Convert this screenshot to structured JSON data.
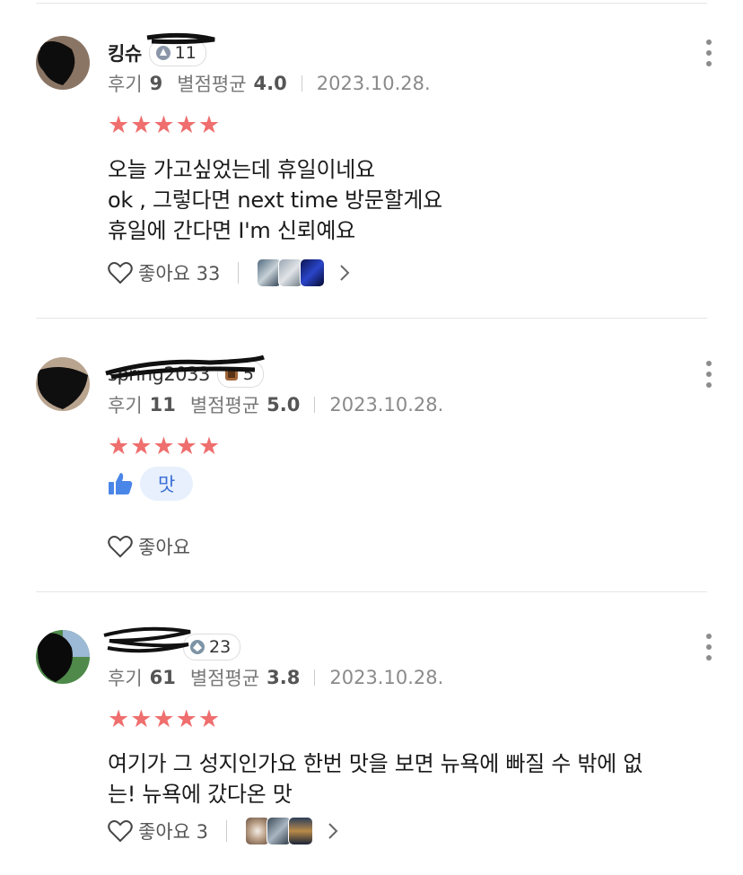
{
  "reviews": [
    {
      "name": "킹슈",
      "badge_count": "11",
      "meta": {
        "reviews_label": "후기",
        "reviews_count": "9",
        "avg_label": "별점평균",
        "avg_value": "4.0",
        "date": "2023.10.28."
      },
      "stars": "★★★★★",
      "text_lines": [
        "오늘 가고싶었는데 휴일이네요",
        "ok , 그렇다면 next time 방문할게요",
        "휴일에 간다면 I'm 신뢰예요"
      ],
      "like_label": "좋아요 33"
    },
    {
      "name": "spring2033",
      "badge_count": "5",
      "meta": {
        "reviews_label": "후기",
        "reviews_count": "11",
        "avg_label": "별점평균",
        "avg_value": "5.0",
        "date": "2023.10.28."
      },
      "stars": "★★★★★",
      "tag": "맛",
      "like_label": "좋아요"
    },
    {
      "name": "",
      "badge_count": "23",
      "meta": {
        "reviews_label": "후기",
        "reviews_count": "61",
        "avg_label": "별점평균",
        "avg_value": "3.8",
        "date": "2023.10.28."
      },
      "stars": "★★★★★",
      "text_lines": [
        "여기가 그 성지인가요 한번 맛을 보면 뉴욕에 빠질 수 밖에 없",
        "는! 뉴욕에 갔다온 맛"
      ],
      "like_label": "좋아요 3"
    }
  ],
  "colors": {
    "star": "#ef6e6e",
    "tag_bg": "#e7f0fc",
    "tag_text": "#3a6fd8",
    "thumb_blue": "#4a86e8"
  }
}
